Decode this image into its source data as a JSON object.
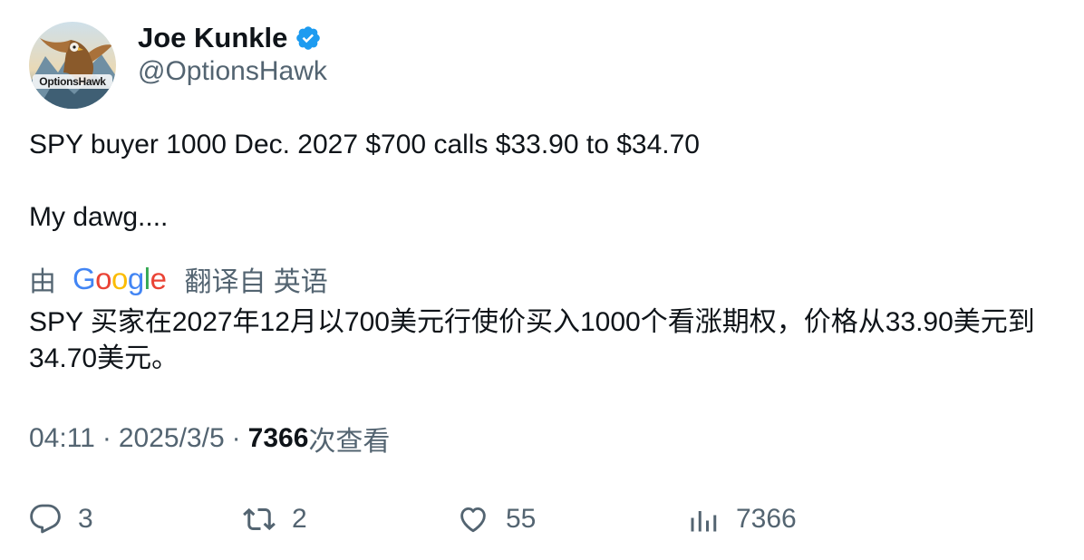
{
  "author": {
    "display_name": "Joe Kunkle",
    "handle": "@OptionsHawk",
    "verified": true,
    "avatar_logo_text": "OptionsHawk"
  },
  "tweet": {
    "line1": "SPY buyer 1000 Dec. 2027 $700 calls $33.90 to $34.70",
    "line2": "My dawg...."
  },
  "translation": {
    "by_label": "由",
    "provider_letters": [
      "G",
      "o",
      "o",
      "g",
      "l",
      "e"
    ],
    "suffix_label": "翻译自 英语",
    "text": "SPY 买家在2027年12月以700美元行使价买入1000个看涨期权，价格从33.90美元到34.70美元。"
  },
  "meta": {
    "time": "04:11",
    "separator": "·",
    "date": "2025/3/5",
    "views_count": "7366",
    "views_label": "次查看"
  },
  "actions": {
    "reply_count": "3",
    "retweet_count": "2",
    "like_count": "55",
    "views_count": "7366",
    "icons": [
      "reply-icon",
      "retweet-icon",
      "like-icon",
      "views-icon"
    ]
  },
  "colors": {
    "verified_badge": "#1d9bf0",
    "secondary_text": "#536471",
    "primary_text": "#0f1419"
  }
}
